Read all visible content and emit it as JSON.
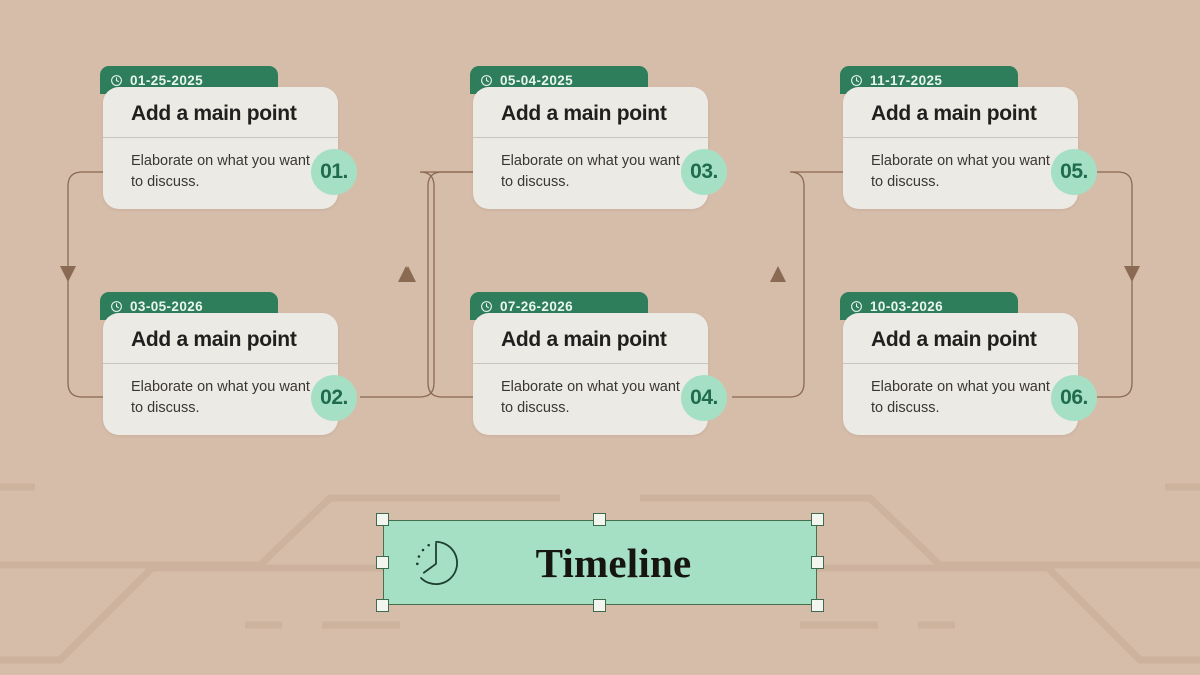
{
  "slide": {
    "background_color": "#d6bdaa",
    "title_banner": {
      "text": "Timeline",
      "background_color": "#a6e0c4",
      "icon": "clock-icon",
      "selected": true
    }
  },
  "theme": {
    "tab_green": "#2e7d5b",
    "card_cream": "#eceae5",
    "badge_mint": "#a6e0c4",
    "badge_text_green": "#1f6b4c",
    "connector_brown": "#8a6a52",
    "heading_dark": "#22201e"
  },
  "cards": [
    {
      "number": "01.",
      "date": "01-25-2025",
      "title": "Add a main point",
      "description": "Elaborate on what you want to discuss.",
      "icon": "clock-icon"
    },
    {
      "number": "02.",
      "date": "03-05-2026",
      "title": "Add a main point",
      "description": "Elaborate on what you want to discuss.",
      "icon": "clock-icon"
    },
    {
      "number": "03.",
      "date": "05-04-2025",
      "title": "Add a main point",
      "description": "Elaborate on what you want to discuss.",
      "icon": "clock-icon"
    },
    {
      "number": "04.",
      "date": "07-26-2026",
      "title": "Add a main point",
      "description": "Elaborate on what you want to discuss.",
      "icon": "clock-icon"
    },
    {
      "number": "05.",
      "date": "11-17-2025",
      "title": "Add a main point",
      "description": "Elaborate on what you want to discuss.",
      "icon": "clock-icon"
    },
    {
      "number": "06.",
      "date": "10-03-2026",
      "title": "Add a main point",
      "description": "Elaborate on what you want to discuss.",
      "icon": "clock-icon"
    }
  ],
  "connectors": [
    {
      "name": "connector-01-to-02",
      "arrow": "down"
    },
    {
      "name": "connector-02-to-03",
      "arrow": "up"
    },
    {
      "name": "connector-03-to-04",
      "arrow": "up"
    },
    {
      "name": "connector-04-to-05",
      "arrow": "up"
    },
    {
      "name": "connector-05-to-06",
      "arrow": "down"
    }
  ],
  "selection_handles": [
    "top-left",
    "top-center",
    "top-right",
    "middle-left",
    "middle-right",
    "bottom-left",
    "bottom-center",
    "bottom-right"
  ]
}
